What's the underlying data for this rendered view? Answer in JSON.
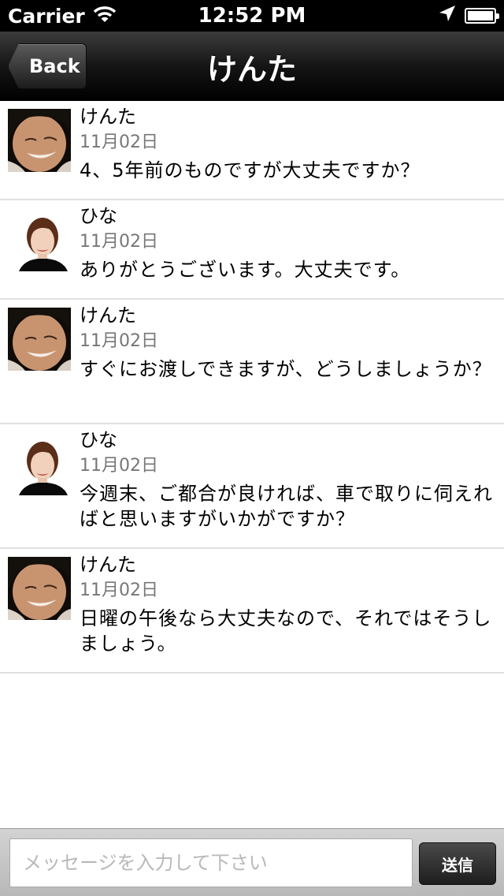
{
  "status_bar": {
    "carrier": "Carrier",
    "time": "12:52 PM",
    "icons": [
      "wifi-icon",
      "location-arrow-icon",
      "battery-icon"
    ]
  },
  "nav": {
    "back_label": "Back",
    "title": "けんた"
  },
  "messages": [
    {
      "sender": "けんた",
      "avatar": "male-avatar",
      "date": "11月02日",
      "text": "4、5年前のものですが大丈夫ですか？"
    },
    {
      "sender": "ひな",
      "avatar": "female-avatar",
      "date": "11月02日",
      "text": "ありがとうございます。大丈夫です。"
    },
    {
      "sender": "けんた",
      "avatar": "male-avatar",
      "date": "11月02日",
      "text": "すぐにお渡しできますが、どうしましょうか？"
    },
    {
      "sender": "ひな",
      "avatar": "female-avatar",
      "date": "11月02日",
      "text": "今週末、ご都合が良ければ、車で取りに伺えればと思いますがいかがですか？"
    },
    {
      "sender": "けんた",
      "avatar": "male-avatar",
      "date": "11月02日",
      "text": "日曜の午後なら大丈夫なので、それではそうしましょう。"
    }
  ],
  "composer": {
    "placeholder": "メッセージを入力して下さい",
    "value": "",
    "send_label": "送信"
  }
}
